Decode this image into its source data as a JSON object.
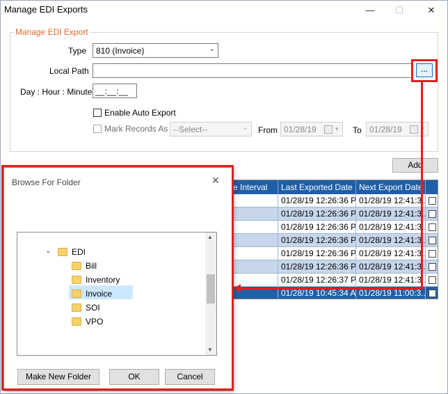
{
  "window": {
    "title": "Manage EDI Exports",
    "minimize": "—",
    "maximize": "☐",
    "close": "✕"
  },
  "form": {
    "group_label": "Manage EDI Export",
    "type_label": "Type",
    "type_value": "810 (Invoice)",
    "local_path_label": "Local Path",
    "local_path_value": "",
    "browse_button": "...",
    "day_hour_minute_label": "Day : Hour : Minute",
    "day_hour_minute_value": "__:__:__",
    "enable_auto_export_label": "Enable Auto Export",
    "mark_records_label": "Mark Records As",
    "mark_records_value": "--Select--",
    "from_label": "From",
    "from_value": "01/28/19",
    "to_label": "To",
    "to_value": "01/28/19",
    "add_button": "Add"
  },
  "grid": {
    "headers": [
      "me Interval",
      "Last Exported Date",
      "Next Export Date"
    ],
    "rows": [
      {
        "last": "01/28/19 12:26:36 P...",
        "next": "01/28/19 12:41:3..."
      },
      {
        "last": "01/28/19 12:26:36 P...",
        "next": "01/28/19 12:41:3..."
      },
      {
        "last": "01/28/19 12:26:36 P...",
        "next": "01/28/19 12:41:3..."
      },
      {
        "last": "01/28/19 12:26:36 P...",
        "next": "01/28/19 12:41:3..."
      },
      {
        "last": "01/28/19 12:26:36 P...",
        "next": "01/28/19 12:41:3..."
      },
      {
        "last": "01/28/19 12:26:36 P...",
        "next": "01/28/19 12:41:3..."
      },
      {
        "last": "01/28/19 12:26:37 P...",
        "next": "01/28/19 12:41:3..."
      },
      {
        "last": "01/28/19 10:45:34 A...",
        "next": "01/28/19 11:00:3..."
      }
    ]
  },
  "browse_dialog": {
    "title": "Browse For Folder",
    "close": "✕",
    "tree": {
      "parent": "EDI",
      "children": [
        "Bill",
        "Inventory",
        "Invoice",
        "SOI",
        "VPO"
      ],
      "selected": "Invoice"
    },
    "make_new_folder": "Make New Folder",
    "ok": "OK",
    "cancel": "Cancel"
  },
  "colors": {
    "accent": "#1f5fa6",
    "group_label": "#e06a2a",
    "annotation": "#e02020"
  }
}
